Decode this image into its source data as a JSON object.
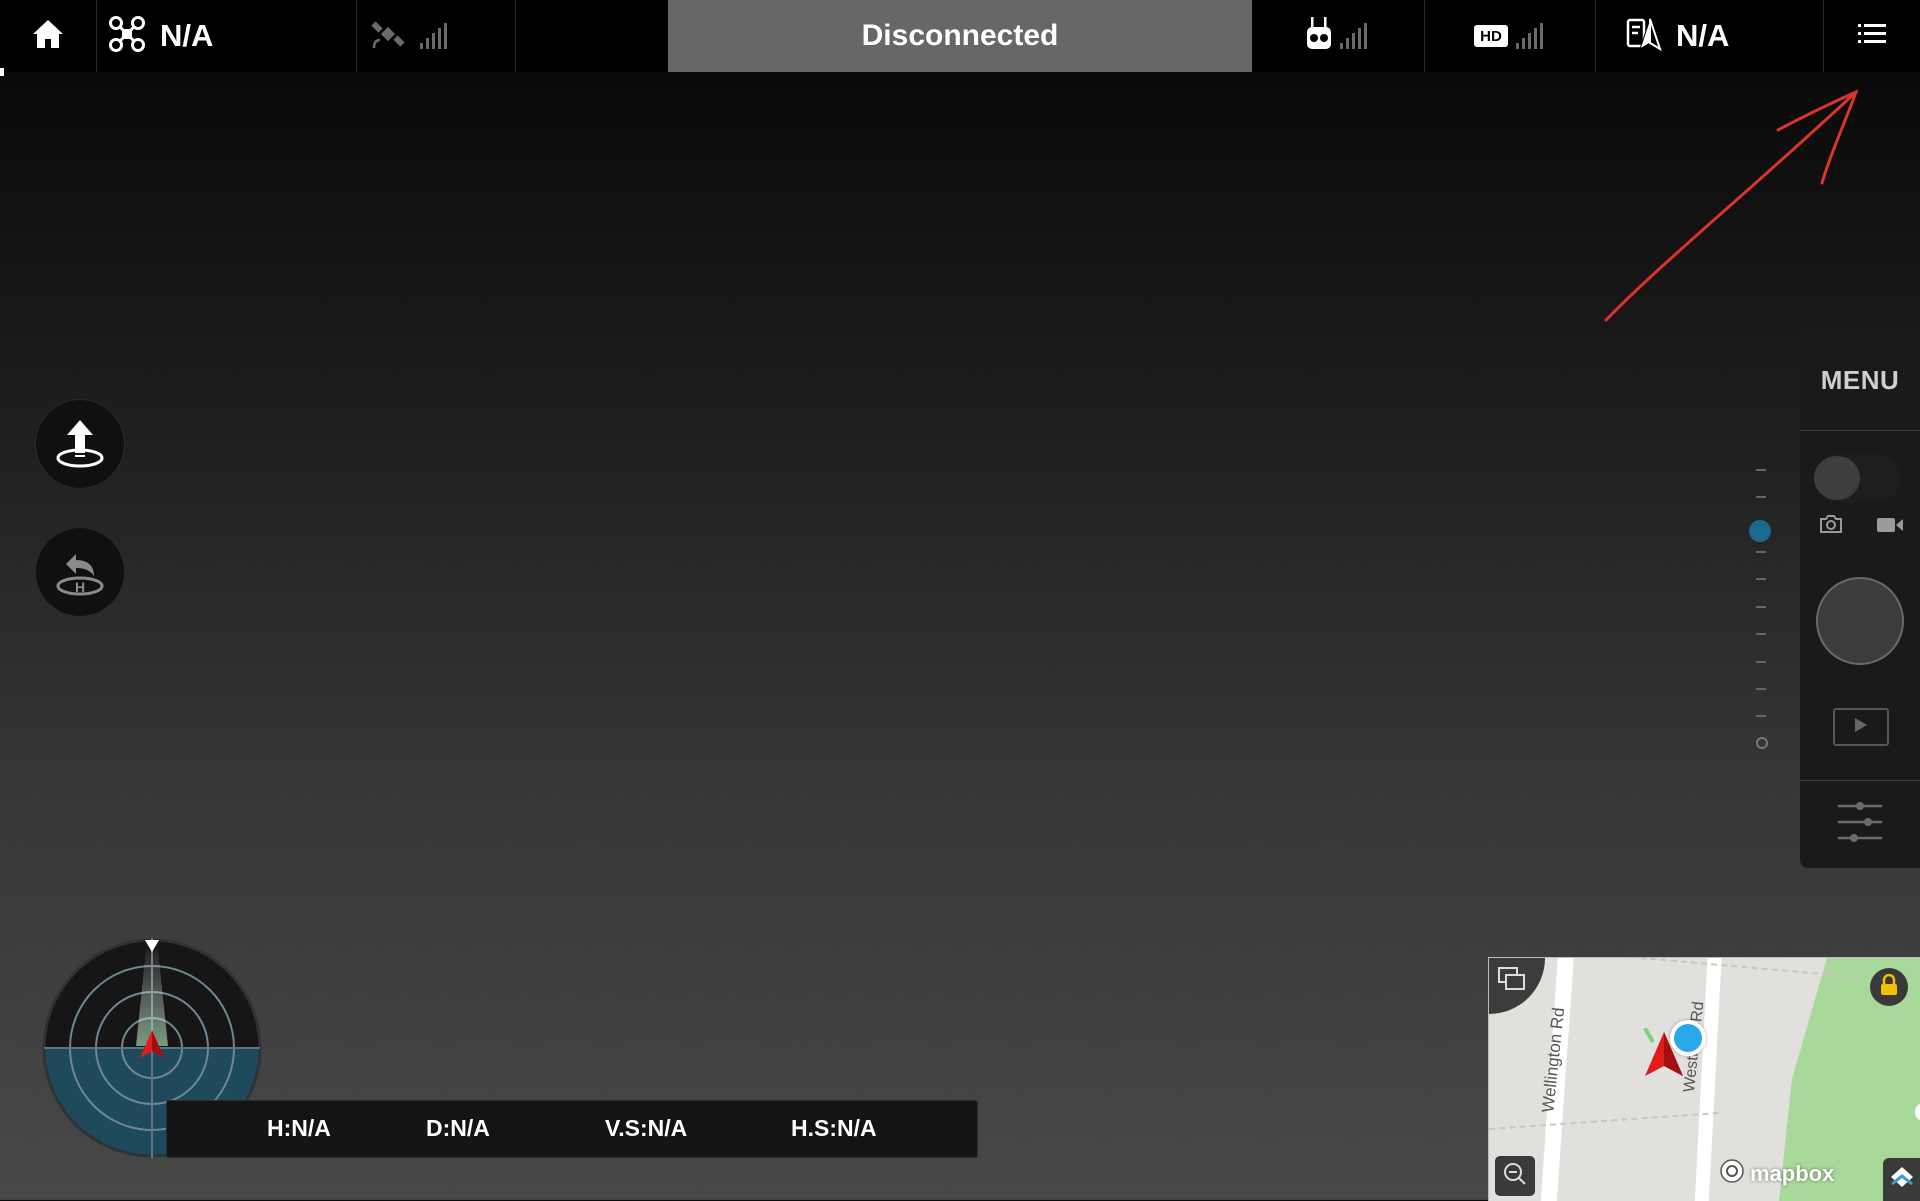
{
  "topbar": {
    "aircraft_status": "N/A",
    "connection_status": "Disconnected",
    "hd_label": "HD",
    "flight_mode": "N/A"
  },
  "right_panel": {
    "menu_label": "MENU"
  },
  "telemetry": {
    "height": "H:N/A",
    "distance": "D:N/A",
    "vertical_speed": "V.S:N/A",
    "horizontal_speed": "H.S:N/A"
  },
  "map": {
    "road_1": "Wellington Rd",
    "road_2": "Westmi... Rd",
    "attribution": "mapbox"
  },
  "colors": {
    "status_bg": "#676767",
    "map_location_dot": "#29a9e9",
    "annotation_arrow": "#d8342b",
    "aircraft_marker": "#e01c1c",
    "radar_lower": "#1f4a5c"
  },
  "icons": [
    "home-icon",
    "drone-icon",
    "satellite-icon",
    "remote-controller-icon",
    "hd-icon",
    "flight-mode-icon",
    "list-menu-icon",
    "takeoff-icon",
    "return-home-icon",
    "photo-mode-icon",
    "video-mode-icon",
    "playback-icon",
    "settings-sliders-icon",
    "map-toggle-icon",
    "lock-icon",
    "zoom-out-icon",
    "layers-icon"
  ]
}
